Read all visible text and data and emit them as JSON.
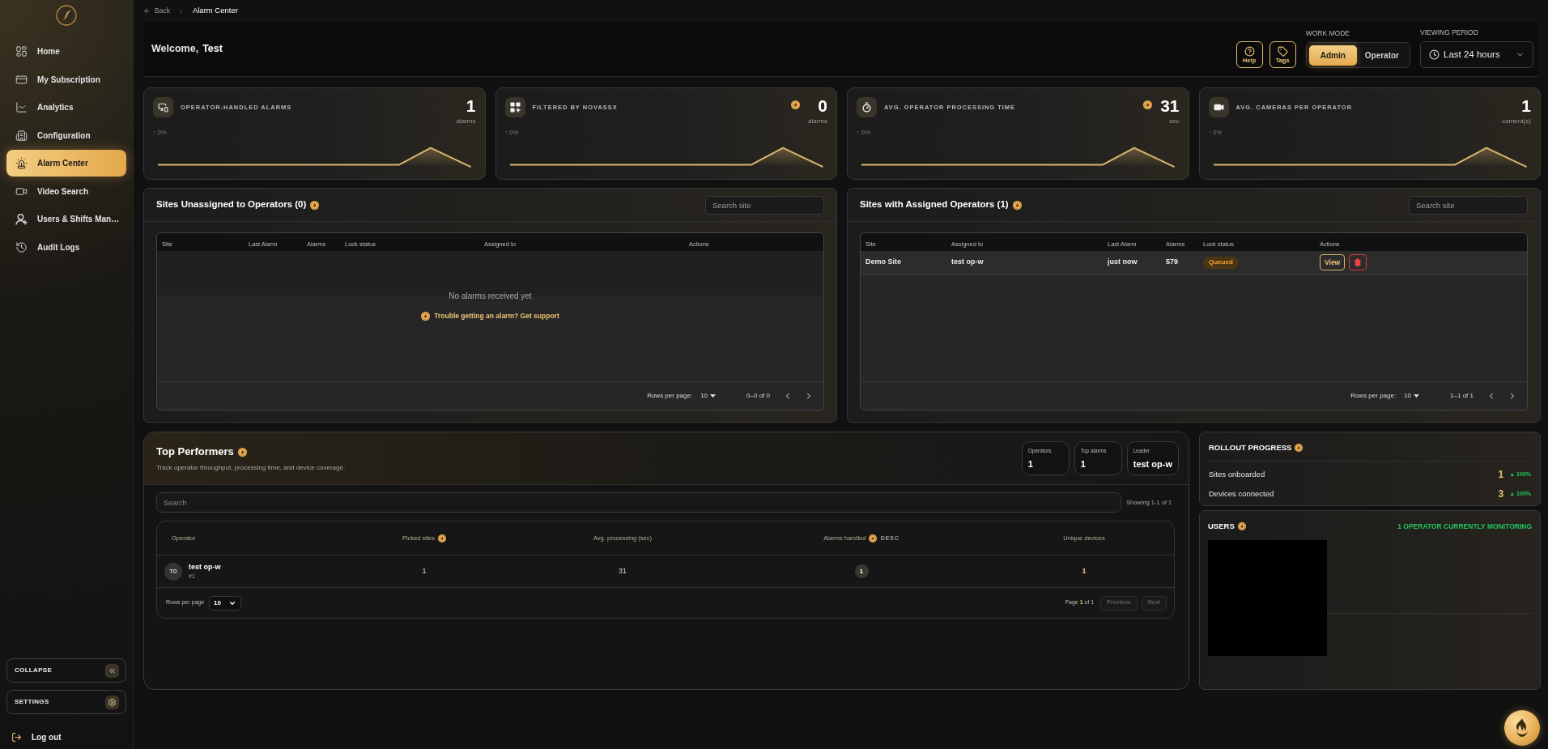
{
  "sidebar": {
    "items": [
      {
        "kind": "home",
        "label": "Home",
        "selected": false
      },
      {
        "kind": "subscription",
        "label": "My Subscription",
        "selected": false
      },
      {
        "kind": "analytics",
        "label": "Analytics",
        "selected": false
      },
      {
        "kind": "configuration",
        "label": "Configuration",
        "selected": false
      },
      {
        "kind": "alarm",
        "label": "Alarm Center",
        "selected": true
      },
      {
        "kind": "video",
        "label": "Video Search",
        "selected": false
      },
      {
        "kind": "users",
        "label": "Users & Shifts Man…",
        "selected": false
      },
      {
        "kind": "audit",
        "label": "Audit Logs",
        "selected": false
      }
    ],
    "collapse": "COLLAPSE",
    "settings": "SETTINGS",
    "logout": "Log out"
  },
  "breadcrumb": {
    "back": "Back",
    "current": "Alarm Center"
  },
  "header": {
    "greeting": "Welcome,",
    "name": "Test",
    "buttons": [
      {
        "kind": "help",
        "label": "Help"
      },
      {
        "kind": "tags",
        "label": "Tags"
      }
    ],
    "work_mode": {
      "label": "WORK MODE",
      "options": [
        {
          "label": "Admin",
          "selected": true
        },
        {
          "label": "Operator",
          "selected": false
        }
      ]
    },
    "viewing_period": {
      "label": "VIEWING PERIOD",
      "value": "Last 24 hours"
    }
  },
  "kpis": [
    {
      "kind": "devices",
      "title": "OPERATOR-HANDLED ALARMS",
      "badge": false,
      "value": "1",
      "unit": "alarms",
      "trend": "↑ 0%"
    },
    {
      "kind": "grid",
      "title": "FILTERED BY NOVASSX",
      "badge": true,
      "value": "0",
      "unit": "alarms",
      "trend": "↑ 0%"
    },
    {
      "kind": "timer",
      "title": "AVG. OPERATOR PROCESSING TIME",
      "badge": true,
      "value": "31",
      "unit": "sec",
      "trend": "↑ 0%"
    },
    {
      "kind": "camera",
      "title": "AVG. CAMERAS PER OPERATOR",
      "badge": false,
      "value": "1",
      "unit": "camera(s)",
      "trend": "↑ 0%"
    }
  ],
  "unassigned_sites": {
    "title": "Sites Unassigned to Operators (0)",
    "search": {
      "placeholder": "Search site"
    },
    "columns": [
      "Site",
      "Last Alarm",
      "Alarms",
      "Lock status",
      "Assigned to",
      "Actions"
    ],
    "empty": {
      "message": "No alarms received yet",
      "link": "Trouble getting an alarm? Get support"
    },
    "footer": {
      "rows_label": "Rows per page:",
      "rows_value": "10",
      "range": "0–0 of 0"
    }
  },
  "assigned_sites": {
    "title": "Sites with Assigned Operators (1)",
    "search": {
      "placeholder": "Search site"
    },
    "columns": [
      "Site",
      "Assigned to",
      "Last Alarm",
      "Alarms",
      "Lock status",
      "Actions"
    ],
    "rows": [
      {
        "site": "Demo Site",
        "assigned_to": "test op-w",
        "last_alarm": "just now",
        "alarms": "579",
        "lock_status": "Queued",
        "actions": [
          {
            "kind": "view",
            "label": "View"
          },
          {
            "kind": "delete"
          }
        ]
      }
    ],
    "footer": {
      "rows_label": "Rows per page:",
      "rows_value": "10",
      "range": "1–1 of 1"
    }
  },
  "top_performers": {
    "title": "Top Performers",
    "subtitle": "Track operator throughput, processing time, and device coverage.",
    "stats": [
      {
        "label": "Operators",
        "value": "1"
      },
      {
        "label": "Top alarms",
        "value": "1"
      },
      {
        "label": "Leader",
        "value": "test op-w"
      }
    ],
    "search": {
      "placeholder": "Search"
    },
    "showing": "Showing 1-1 of 1",
    "columns": [
      {
        "label": "Operator",
        "badge": false
      },
      {
        "label": "Picked sites",
        "badge": true
      },
      {
        "label": "Avg. processing (sec)",
        "badge": false
      },
      {
        "label": "Alarms handled",
        "badge": true,
        "sort": "DESC"
      },
      {
        "label": "Unique devices",
        "badge": false
      }
    ],
    "rows": [
      {
        "initials": "TO",
        "name": "test op-w",
        "rank": "#1",
        "picked_sites": "1",
        "avg_processing": "31",
        "alarms_handled": "1",
        "unique_devices": "1"
      }
    ],
    "footer": {
      "rows_label": "Rows per page",
      "rows_value": "10",
      "page_label": "Page",
      "page_current": "1",
      "page_total": "of 1",
      "buttons": [
        {
          "label": "Previous",
          "disabled": true
        },
        {
          "label": "Next",
          "disabled": true
        }
      ]
    }
  },
  "rollout": {
    "title": "ROLLOUT PROGRESS",
    "rows": [
      {
        "label": "Sites onboarded",
        "value": "1",
        "change": "▲ 100%"
      },
      {
        "label": "Devices connected",
        "value": "3",
        "change": "▲ 100%"
      }
    ]
  },
  "users": {
    "title": "USERS",
    "status": "1 OPERATOR CURRENTLY MONITORING"
  }
}
